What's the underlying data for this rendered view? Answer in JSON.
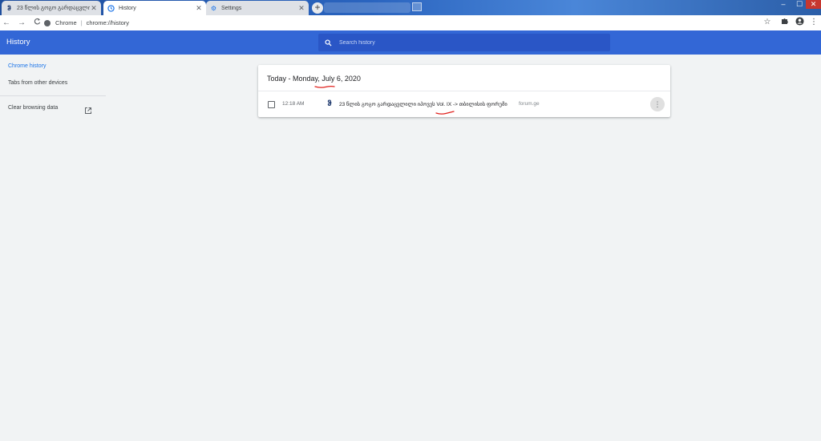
{
  "tabs": [
    {
      "title": "23 წლის გოგო გარდაცვლილი ···",
      "icon": "forum-favicon",
      "active": false
    },
    {
      "title": "History",
      "icon": "history-icon",
      "active": true
    },
    {
      "title": "Settings",
      "icon": "gear-icon",
      "active": false
    }
  ],
  "window_controls": {
    "minimize": "–",
    "maximize": "☐",
    "close": "✕"
  },
  "toolbar": {
    "back": "←",
    "forward": "→",
    "reload": "C",
    "omnibox": {
      "chip": "Chrome",
      "url": "chrome://history"
    },
    "star": "☆",
    "extensions": "✱",
    "profile": "●",
    "menu": "⋮"
  },
  "header": {
    "title": "History",
    "search_placeholder": "Search history"
  },
  "sidebar": {
    "items": [
      {
        "label": "Chrome history",
        "selected": true
      },
      {
        "label": "Tabs from other devices",
        "selected": false
      },
      {
        "label": "Clear browsing data",
        "selected": false,
        "icon": "external-link-icon"
      }
    ]
  },
  "history": {
    "day_title": "Today - Monday, July 6, 2020",
    "entries": [
      {
        "time": "12:18 AM",
        "favicon": "ჵ",
        "title": "23 წლის გოგო გარდაცვლილი იპოვეს Vol. IX -> თბილისის ფორუმი",
        "domain": "forum.ge",
        "menu": "⋮"
      }
    ]
  },
  "colors": {
    "header_blue": "#3367d6",
    "accent": "#1a73e8",
    "annotation_red": "#e0221e"
  }
}
